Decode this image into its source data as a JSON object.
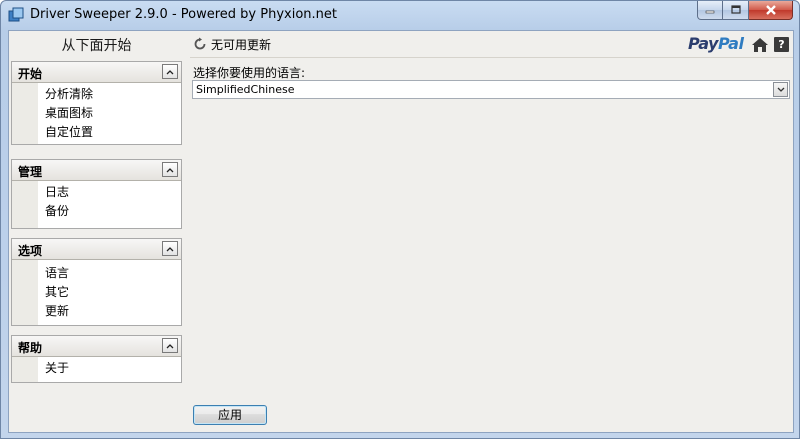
{
  "window": {
    "title": "Driver Sweeper 2.9.0 - Powered by Phyxion.net",
    "buttons": [
      "minimize-icon",
      "maximize-icon",
      "close-icon"
    ]
  },
  "sidebar": {
    "header": "从下面开始",
    "groups": [
      {
        "title": "开始",
        "items": [
          "分析清除",
          "桌面图标",
          "自定位置"
        ]
      },
      {
        "title": "管理",
        "items": [
          "日志",
          "备份"
        ]
      },
      {
        "title": "选项",
        "items": [
          "语言",
          "其它",
          "更新"
        ]
      },
      {
        "title": "帮助",
        "items": [
          "关于"
        ]
      }
    ]
  },
  "topbar": {
    "update_status": "无可用更新",
    "paypal_pay": "Pay",
    "paypal_pal": "Pal",
    "help_glyph": "?"
  },
  "main": {
    "language_label": "选择你要使用的语言:",
    "language_value": "SimplifiedChinese",
    "apply_label": "应用"
  },
  "colors": {
    "paypal_dark": "#2b3d6e",
    "paypal_light": "#2f7cc1",
    "panel_bg": "#f0efec",
    "focus_border": "#3c7fb1"
  }
}
